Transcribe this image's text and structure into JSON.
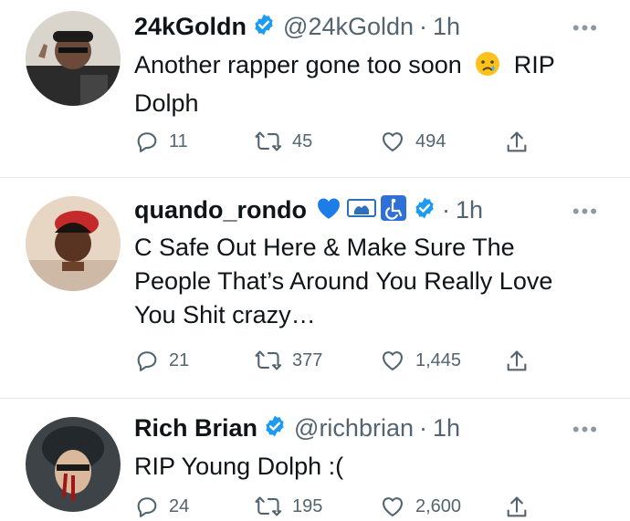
{
  "tweets": [
    {
      "name": "24kGoldn",
      "handle": "@24kGoldn",
      "separator": "·",
      "time": "1h",
      "text_line1": "Another rapper gone too soon",
      "emoji": "crying-face",
      "text_after_emoji": "RIP",
      "text_line2": "Dolph",
      "replies": "11",
      "retweets": "45",
      "likes": "494",
      "more": "•••"
    },
    {
      "name": "quando_rondo",
      "separator": "·",
      "time": "1h",
      "name_badges": [
        "blue-heart-icon",
        "prayer-flag-icon",
        "wheelchair-icon",
        "verified-icon"
      ],
      "text_line1": "C Safe Out Here & Make Sure The",
      "text_line2": "People That’s Around You Really Love",
      "text_line3": "You Shit crazy…",
      "replies": "21",
      "retweets": "377",
      "likes": "1,445",
      "more": "•••"
    },
    {
      "name": "Rich Brian",
      "handle": "@richbrian",
      "separator": "·",
      "time": "1h",
      "text_line1": "RIP Young Dolph :(",
      "replies": "24",
      "retweets": "195",
      "likes": "2,600",
      "more": "•••"
    }
  ],
  "colors": {
    "verified": "#1d9bf0",
    "muted": "#536471",
    "text": "#0f1419",
    "divider": "#e6e9ec"
  }
}
